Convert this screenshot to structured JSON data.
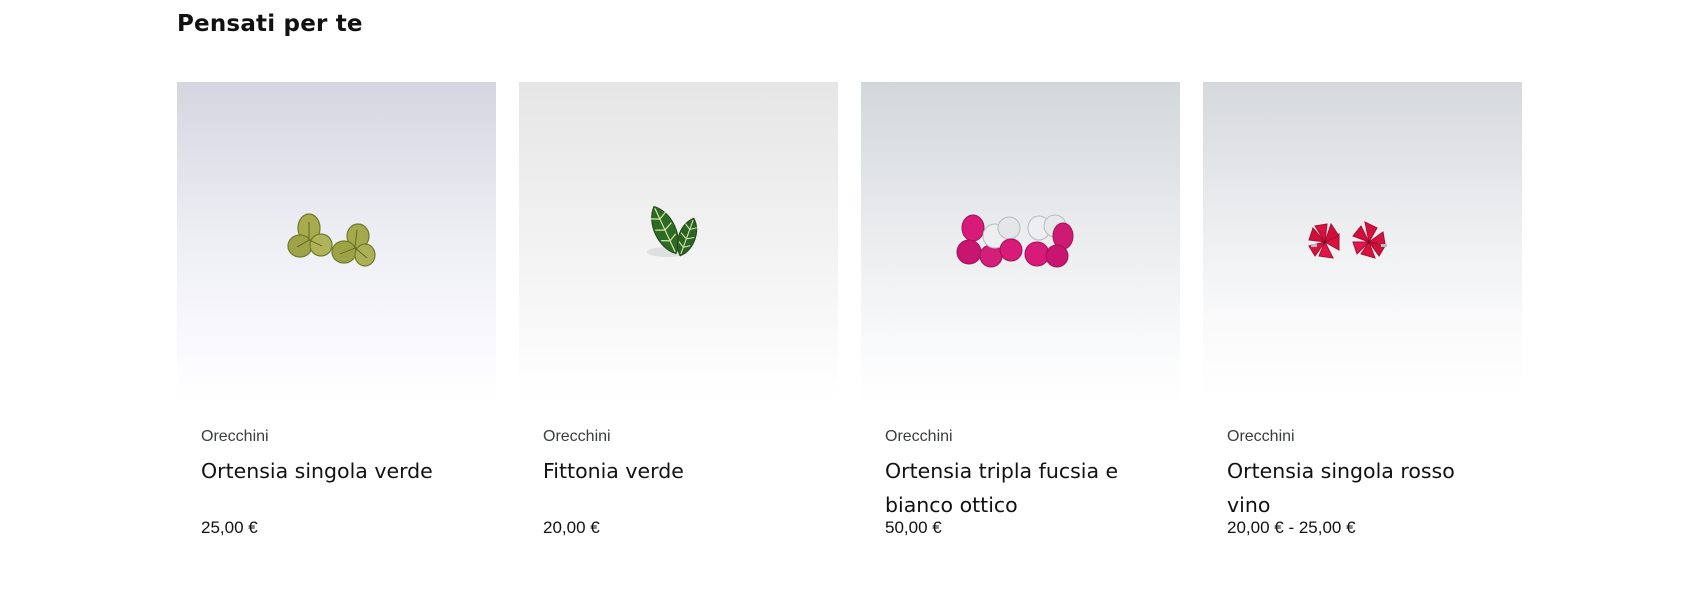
{
  "section": {
    "title": "Pensati per te"
  },
  "products": [
    {
      "category": "Orecchini",
      "name": "Ortensia singola verde",
      "price": "25,00 €",
      "image_icon": "green-hydrangea-earrings-image",
      "accent": "#9aa84a"
    },
    {
      "category": "Orecchini",
      "name": "Fittonia verde",
      "price": "20,00 €",
      "image_icon": "fittonia-leaf-earrings-image",
      "accent": "#2f6a25"
    },
    {
      "category": "Orecchini",
      "name": "Ortensia tripla fucsia e bianco ottico",
      "price": "50,00 €",
      "image_icon": "fuchsia-white-hydrangea-earrings-image",
      "accent": "#d81b78"
    },
    {
      "category": "Orecchini",
      "name": "Ortensia singola rosso vino",
      "price": "20,00 € - 25,00 €",
      "image_icon": "red-hydrangea-earrings-image",
      "accent": "#d8123f"
    }
  ]
}
